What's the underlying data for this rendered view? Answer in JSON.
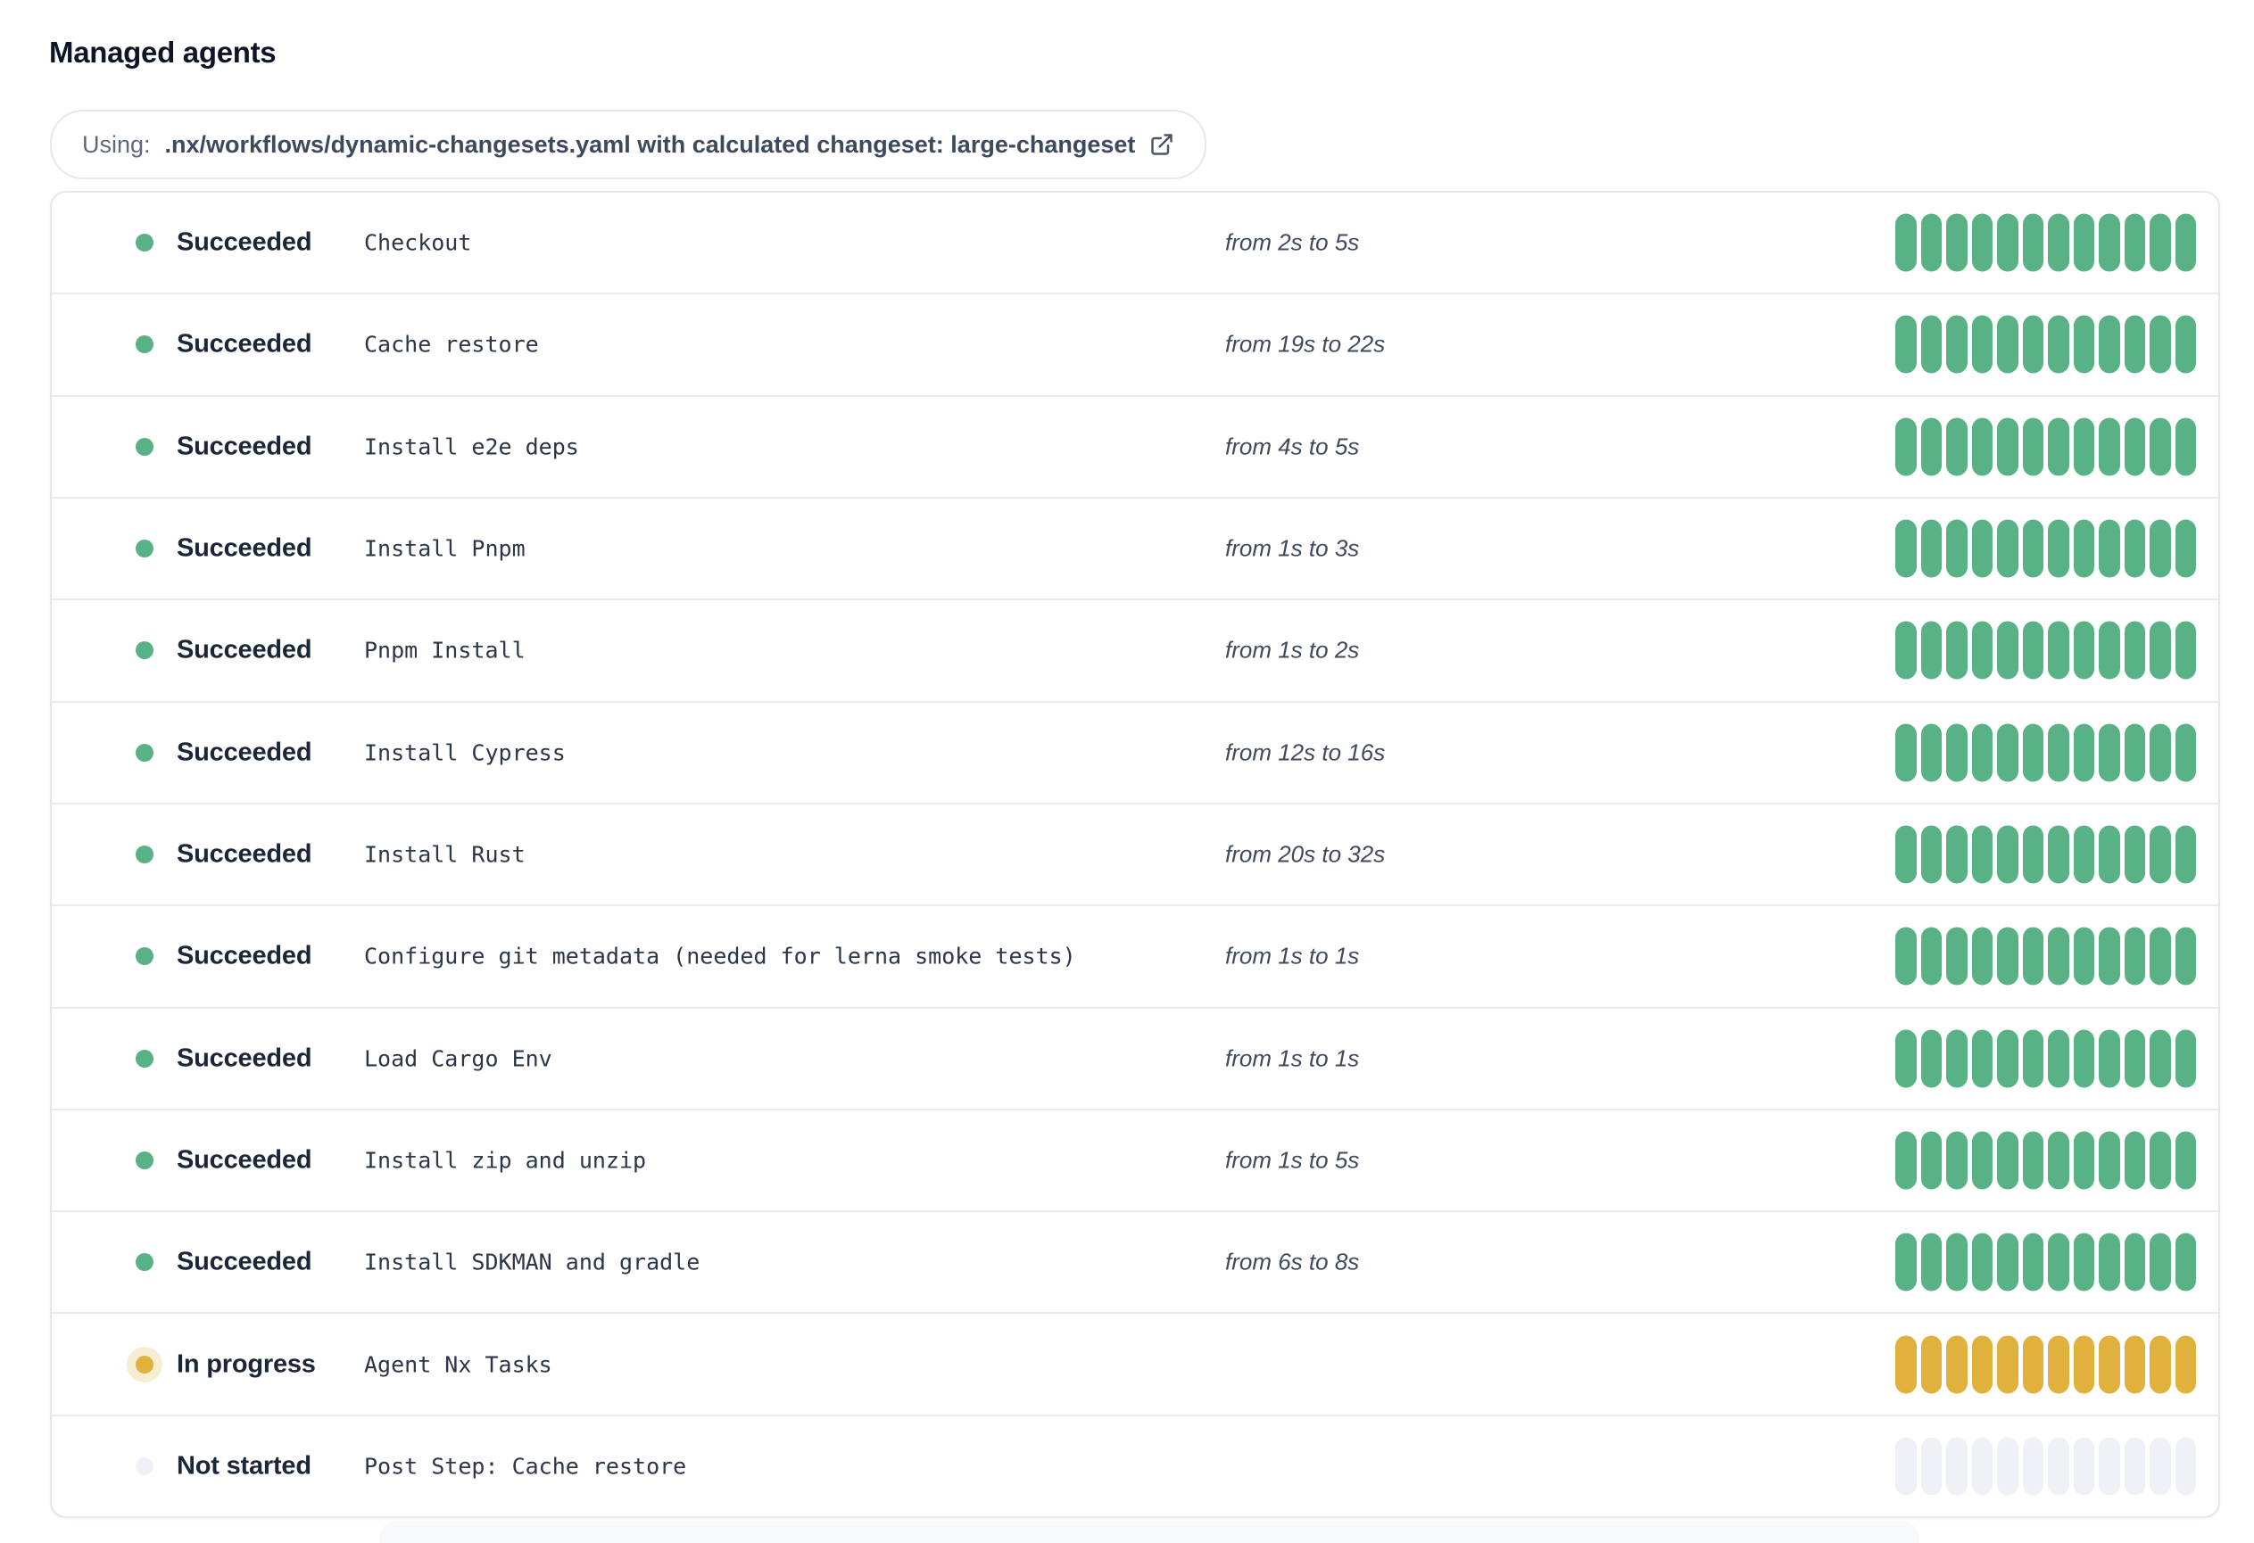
{
  "page": {
    "title": "Managed agents"
  },
  "workflow_banner": {
    "prefix": "Using:",
    "path_text": ".nx/workflows/dynamic-changesets.yaml with calculated changeset: large-changeset",
    "icon": "external-link-icon"
  },
  "colors": {
    "succeeded": "#58b286",
    "in_progress": "#e0b13c",
    "in_progress_halo": "#f7edd3",
    "not_started": "#eef2f7"
  },
  "progress": {
    "segments_per_bar": 12
  },
  "agents": {
    "rows": [
      {
        "state": "succeeded",
        "status": "Succeeded",
        "step": "Checkout",
        "timing": "from 2s to 5s"
      },
      {
        "state": "succeeded",
        "status": "Succeeded",
        "step": "Cache restore",
        "timing": "from 19s to 22s"
      },
      {
        "state": "succeeded",
        "status": "Succeeded",
        "step": "Install e2e deps",
        "timing": "from 4s to 5s"
      },
      {
        "state": "succeeded",
        "status": "Succeeded",
        "step": "Install Pnpm",
        "timing": "from 1s to 3s"
      },
      {
        "state": "succeeded",
        "status": "Succeeded",
        "step": "Pnpm Install",
        "timing": "from 1s to 2s"
      },
      {
        "state": "succeeded",
        "status": "Succeeded",
        "step": "Install Cypress",
        "timing": "from 12s to 16s"
      },
      {
        "state": "succeeded",
        "status": "Succeeded",
        "step": "Install Rust",
        "timing": "from 20s to 32s"
      },
      {
        "state": "succeeded",
        "status": "Succeeded",
        "step": "Configure git metadata (needed for lerna smoke tests)",
        "timing": "from 1s to 1s"
      },
      {
        "state": "succeeded",
        "status": "Succeeded",
        "step": "Load Cargo Env",
        "timing": "from 1s to 1s"
      },
      {
        "state": "succeeded",
        "status": "Succeeded",
        "step": "Install zip and unzip",
        "timing": "from 1s to 5s"
      },
      {
        "state": "succeeded",
        "status": "Succeeded",
        "step": "Install SDKMAN and gradle",
        "timing": "from 6s to 8s"
      },
      {
        "state": "in-progress",
        "status": "In progress",
        "step": "Agent Nx Tasks",
        "timing": ""
      },
      {
        "state": "not-started",
        "status": "Not started",
        "step": "Post Step: Cache restore",
        "timing": ""
      }
    ]
  }
}
